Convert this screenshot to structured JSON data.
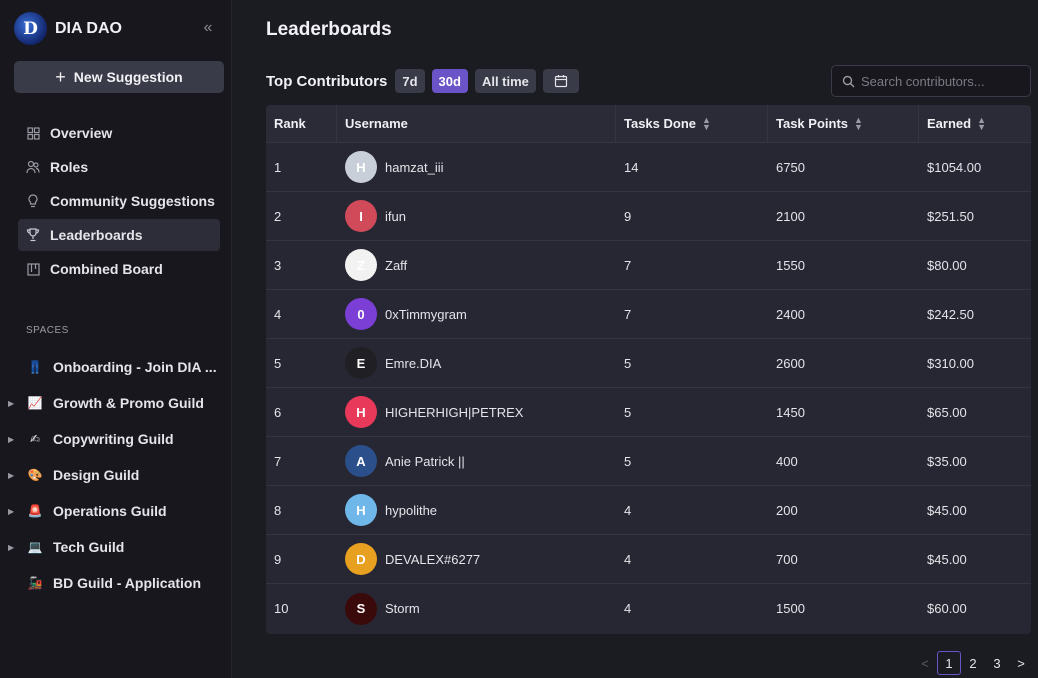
{
  "sidebar": {
    "brand": {
      "logo_letter": "D",
      "name": "DIA DAO"
    },
    "collapse_icon": "double-chevron-left-icon",
    "new_suggestion_label": "New Suggestion",
    "nav": [
      {
        "label": "Overview",
        "icon": "grid-icon"
      },
      {
        "label": "Roles",
        "icon": "users-icon"
      },
      {
        "label": "Community Suggestions",
        "icon": "lightbulb-icon"
      },
      {
        "label": "Leaderboards",
        "icon": "trophy-icon",
        "active": true
      },
      {
        "label": "Combined Board",
        "icon": "board-icon"
      }
    ],
    "spaces_title": "SPACES",
    "spaces": [
      {
        "label": "Onboarding - Join DIA ...",
        "emoji": "👖",
        "caret": false
      },
      {
        "label": "Growth & Promo Guild",
        "emoji": "📈",
        "caret": true
      },
      {
        "label": "Copywriting Guild",
        "emoji": "✍",
        "caret": true
      },
      {
        "label": "Design Guild",
        "emoji": "🎨",
        "caret": true
      },
      {
        "label": "Operations Guild",
        "emoji": "🚨",
        "caret": true
      },
      {
        "label": "Tech Guild",
        "emoji": "💻",
        "caret": true
      },
      {
        "label": "BD Guild - Application",
        "emoji": "🚂",
        "caret": false
      }
    ]
  },
  "main": {
    "title": "Leaderboards",
    "section_title": "Top Contributors",
    "filters": [
      {
        "label": "7d",
        "active": false
      },
      {
        "label": "30d",
        "active": true
      },
      {
        "label": "All time",
        "active": false
      }
    ],
    "search_placeholder": "Search contributors...",
    "columns": [
      "Rank",
      "Username",
      "Tasks Done",
      "Task Points",
      "Earned"
    ],
    "rows": [
      {
        "rank": "1",
        "username": "hamzat_iii",
        "tasks": "14",
        "points": "6750",
        "earned": "$1054.00",
        "avatar_color": "#c9cfd8",
        "avatar_letter": "H"
      },
      {
        "rank": "2",
        "username": "ifun",
        "tasks": "9",
        "points": "2100",
        "earned": "$251.50",
        "avatar_color": "#d04a5a",
        "avatar_letter": "I"
      },
      {
        "rank": "3",
        "username": "Zaff",
        "tasks": "7",
        "points": "1550",
        "earned": "$80.00",
        "avatar_color": "#f2f2f2",
        "avatar_letter": "Z"
      },
      {
        "rank": "4",
        "username": "0xTimmygram",
        "tasks": "7",
        "points": "2400",
        "earned": "$242.50",
        "avatar_color": "#7b3fd6",
        "avatar_letter": "0"
      },
      {
        "rank": "5",
        "username": "Emre.DIA",
        "tasks": "5",
        "points": "2600",
        "earned": "$310.00",
        "avatar_color": "#202024",
        "avatar_letter": "E"
      },
      {
        "rank": "6",
        "username": "HIGHERHIGH|PETREX",
        "tasks": "5",
        "points": "1450",
        "earned": "$65.00",
        "avatar_color": "#e8395a",
        "avatar_letter": "H"
      },
      {
        "rank": "7",
        "username": "Anie Patrick ||",
        "tasks": "5",
        "points": "400",
        "earned": "$35.00",
        "avatar_color": "#2a4f8a",
        "avatar_letter": "A"
      },
      {
        "rank": "8",
        "username": "hypolithe",
        "tasks": "4",
        "points": "200",
        "earned": "$45.00",
        "avatar_color": "#6fb7e8",
        "avatar_letter": "H"
      },
      {
        "rank": "9",
        "username": "DEVALEX#6277",
        "tasks": "4",
        "points": "700",
        "earned": "$45.00",
        "avatar_color": "#e8a020",
        "avatar_letter": "D"
      },
      {
        "rank": "10",
        "username": "Storm",
        "tasks": "4",
        "points": "1500",
        "earned": "$60.00",
        "avatar_color": "#3a0a0a",
        "avatar_letter": "S"
      }
    ],
    "pagination": {
      "prev": "<",
      "pages": [
        "1",
        "2",
        "3"
      ],
      "current": "1",
      "next": ">"
    }
  }
}
